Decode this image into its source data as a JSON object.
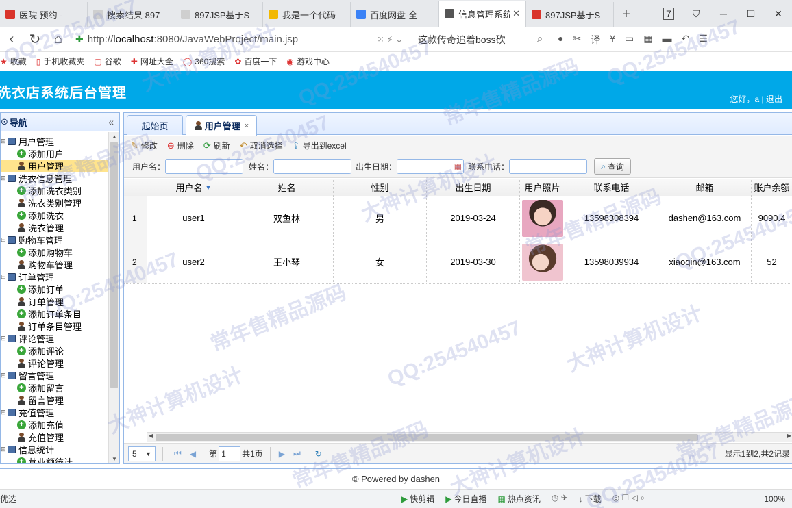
{
  "browser": {
    "tabs": [
      {
        "title": "医院 预约 -",
        "color": "#d9342b",
        "active": false
      },
      {
        "title": "搜索结果 897",
        "color": "#cfcfcf",
        "active": false
      },
      {
        "title": "897JSP基于S",
        "color": "#cfcfcf",
        "active": false
      },
      {
        "title": "我是一个代码",
        "color": "#f2b800",
        "active": false
      },
      {
        "title": "百度网盘-全",
        "color": "#3b82f6",
        "active": false
      },
      {
        "title": "信息管理系统",
        "color": "#555555",
        "active": true
      },
      {
        "title": "897JSP基于S",
        "color": "#d9342b",
        "active": false
      }
    ],
    "new_tab": "+",
    "tab_count": "7",
    "url_prefix": "http://",
    "url_host": "localhost",
    "url_rest": ":8080/JavaWebProject/main.jsp",
    "search_text": "这款传奇追着boss砍",
    "bookmarks": [
      "收藏",
      "手机收藏夹",
      "谷歌",
      "网址大全",
      "360搜索",
      "百度一下",
      "游戏中心"
    ]
  },
  "app": {
    "title": "洗衣店系统后台管理",
    "user_greeting": "您好，a | 退出"
  },
  "nav": {
    "title": "导航",
    "collapse": "«",
    "items": [
      {
        "label": "用户管理",
        "level": 0,
        "icon": "pc"
      },
      {
        "label": "添加用户",
        "level": 1,
        "icon": "add"
      },
      {
        "label": "用户管理",
        "level": 1,
        "icon": "user",
        "selected": true
      },
      {
        "label": "洗衣信息管理",
        "level": 0,
        "icon": "pc"
      },
      {
        "label": "添加洗衣类别",
        "level": 1,
        "icon": "add"
      },
      {
        "label": "洗衣类别管理",
        "level": 1,
        "icon": "user"
      },
      {
        "label": "添加洗衣",
        "level": 1,
        "icon": "add"
      },
      {
        "label": "洗衣管理",
        "level": 1,
        "icon": "user"
      },
      {
        "label": "购物车管理",
        "level": 0,
        "icon": "pc"
      },
      {
        "label": "添加购物车",
        "level": 1,
        "icon": "add"
      },
      {
        "label": "购物车管理",
        "level": 1,
        "icon": "user"
      },
      {
        "label": "订单管理",
        "level": 0,
        "icon": "pc"
      },
      {
        "label": "添加订单",
        "level": 1,
        "icon": "add"
      },
      {
        "label": "订单管理",
        "level": 1,
        "icon": "user"
      },
      {
        "label": "添加订单条目",
        "level": 1,
        "icon": "add"
      },
      {
        "label": "订单条目管理",
        "level": 1,
        "icon": "user"
      },
      {
        "label": "评论管理",
        "level": 0,
        "icon": "pc"
      },
      {
        "label": "添加评论",
        "level": 1,
        "icon": "add"
      },
      {
        "label": "评论管理",
        "level": 1,
        "icon": "user"
      },
      {
        "label": "留言管理",
        "level": 0,
        "icon": "pc"
      },
      {
        "label": "添加留言",
        "level": 1,
        "icon": "add"
      },
      {
        "label": "留言管理",
        "level": 1,
        "icon": "user"
      },
      {
        "label": "充值管理",
        "level": 0,
        "icon": "pc"
      },
      {
        "label": "添加充值",
        "level": 1,
        "icon": "add"
      },
      {
        "label": "充值管理",
        "level": 1,
        "icon": "user"
      },
      {
        "label": "信息统计",
        "level": 0,
        "icon": "pc"
      },
      {
        "label": "营业额统计",
        "level": 1,
        "icon": "add"
      }
    ]
  },
  "main": {
    "tabs": [
      {
        "label": "起始页",
        "active": false
      },
      {
        "label": "用户管理",
        "active": true,
        "closable": true
      }
    ],
    "toolbar": [
      "修改",
      "删除",
      "刷新",
      "取消选择",
      "导出到excel"
    ],
    "filters": {
      "username_label": "用户名：",
      "name_label": "姓名：",
      "birth_label": "出生日期：",
      "phone_label": "联系电话：",
      "query": "查询"
    },
    "columns": [
      "用户名",
      "姓名",
      "性别",
      "出生日期",
      "用户照片",
      "联系电话",
      "邮箱",
      "账户余额"
    ],
    "rows": [
      {
        "num": "1",
        "username": "user1",
        "name": "双鱼林",
        "gender": "男",
        "birth": "2019-03-24",
        "phone": "13598308394",
        "email": "dashen@163.com",
        "balance": "9090.4"
      },
      {
        "num": "2",
        "username": "user2",
        "name": "王小琴",
        "gender": "女",
        "birth": "2019-03-30",
        "phone": "13598039934",
        "email": "xiaoqin@163.com",
        "balance": "52"
      }
    ],
    "pager": {
      "page_size": "5",
      "page_label": "第",
      "page": "1",
      "total": "共1页",
      "info": "显示1到2,共2记录"
    }
  },
  "footer": "© Powered by dashen",
  "statusbar": {
    "left": "优选",
    "items": [
      "快剪辑",
      "今日直播",
      "热点资讯",
      "下载"
    ],
    "zoom": "100%"
  },
  "watermarks": [
    "QQ:254540457",
    "常年售精品源码",
    "大神计算机设计"
  ]
}
